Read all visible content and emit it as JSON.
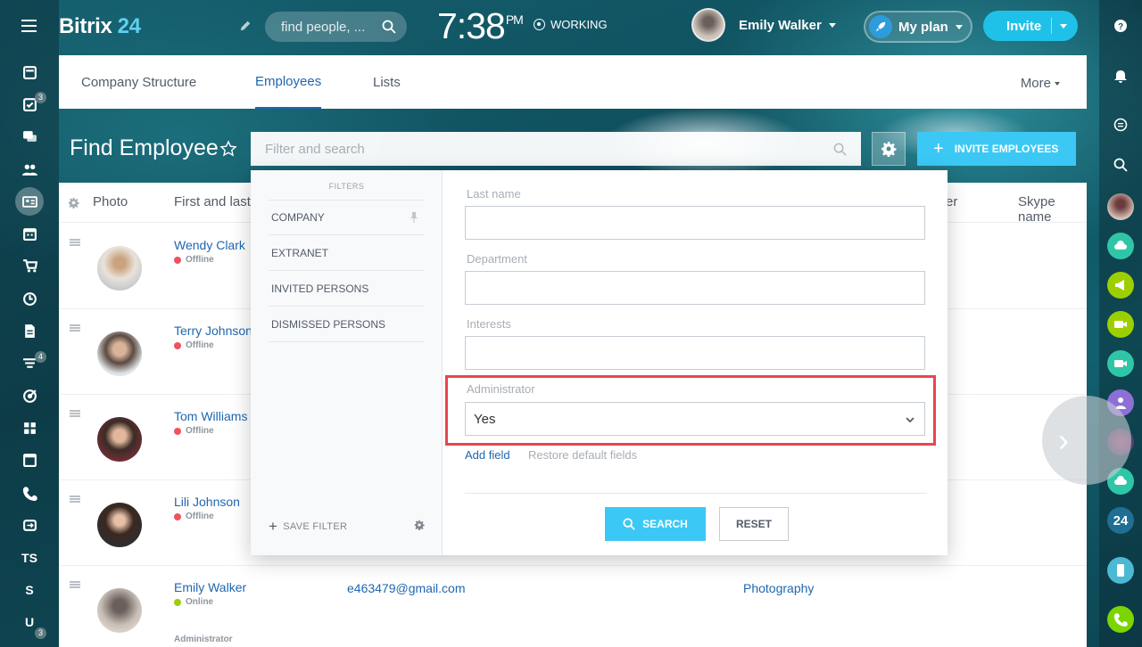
{
  "header": {
    "logo_part1": "Bitrix",
    "logo_part2": "24",
    "search_placeholder": "find people, ...",
    "time": "7:38",
    "ampm": "PM",
    "work_status": "WORKING",
    "user_name": "Emily Walker",
    "myplan_label": "My plan",
    "invite_label": "Invite"
  },
  "left_nav": {
    "counts": {
      "tasks": "3",
      "filter": "4",
      "user": "3"
    },
    "labels": {
      "ts": "TS",
      "s": "S",
      "u": "U"
    }
  },
  "tabs": {
    "items": [
      "Company Structure",
      "Employees",
      "Lists"
    ],
    "active": "Employees",
    "more": "More"
  },
  "page": {
    "title": "Find Employee",
    "filter_placeholder": "Filter and search",
    "invite_employees": "INVITE EMPLOYEES"
  },
  "grid": {
    "columns": {
      "photo": "Photo",
      "name": "First and last",
      "partial": "er",
      "skype": "Skype name"
    },
    "rows": [
      {
        "name": "Wendy Clark",
        "status": "Offline"
      },
      {
        "name": "Terry Johnson",
        "status": "Offline"
      },
      {
        "name": "Tom Williams",
        "status": "Offline"
      },
      {
        "name": "Lili Johnson",
        "status": "Offline"
      },
      {
        "name": "Emily Walker",
        "status": "Online",
        "role": "Administrator",
        "email": "e463479@gmail.com",
        "interests": "Photography"
      }
    ]
  },
  "filter_popup": {
    "filters_header": "FILTERS",
    "filters": [
      "COMPANY",
      "EXTRANET",
      "INVITED PERSONS",
      "DISMISSED PERSONS"
    ],
    "save_filter": "SAVE FILTER",
    "fields": {
      "last_name": "Last name",
      "department": "Department",
      "interests": "Interests",
      "administrator": "Administrator"
    },
    "administrator_value": "Yes",
    "add_field": "Add field",
    "restore_default": "Restore default fields",
    "search_button": "SEARCH",
    "reset_button": "RESET"
  },
  "colors": {
    "accent": "#3bc8f5",
    "link": "#2067b0",
    "highlight": "#e8464f",
    "offline": "#f0525e",
    "online": "#9dcf00"
  }
}
